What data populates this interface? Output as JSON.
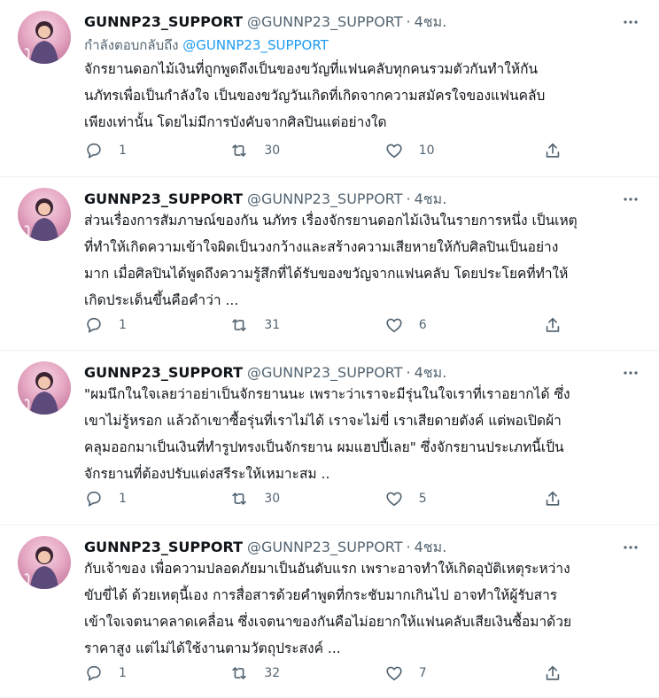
{
  "colors": {
    "text": "#0f1419",
    "secondary": "#536471",
    "link": "#1d9bf0",
    "divider": "#eff3f4",
    "avatar_bg": "#e6a9c4"
  },
  "icons": {
    "more": "more-dots-icon",
    "reply": "reply-bubble-icon",
    "retweet": "retweet-icon",
    "like": "heart-icon",
    "share": "share-upload-icon"
  },
  "tweets": [
    {
      "name": "GUNNP23_SUPPORT",
      "handle": "@GUNNP23_SUPPORT",
      "dot": "·",
      "time": "4ชม.",
      "reply_prefix": "กำลังตอบกลับถึง",
      "reply_mention": "@GUNNP23_SUPPORT",
      "text": "จักรยานดอกไม้เงินที่ถูกพูดถึงเป็นของขวัญที่แฟนคลับทุกคนรวมตัวกันทำให้กัน\nนภัทรเพื่อเป็นกำลังใจ เป็นของขวัญวันเกิดที่เกิดจากความสมัครใจของแฟนคลับ\nเพียงเท่านั้น โดยไม่มีการบังคับจากศิลปินแต่อย่างใด",
      "replies": "1",
      "retweets": "30",
      "likes": "10"
    },
    {
      "name": "GUNNP23_SUPPORT",
      "handle": "@GUNNP23_SUPPORT",
      "dot": "·",
      "time": "4ชม.",
      "text": "ส่วนเรื่องการสัมภาษณ์ของกัน นภัทร เรื่องจักรยานดอกไม้เงินในรายการหนึ่ง เป็นเหตุ\nที่ทำให้เกิดความเข้าใจผิดเป็นวงกว้างและสร้างความเสียหายให้กับศิลปินเป็นอย่าง\nมาก เมื่อศิลปินได้พูดถึงความรู้สึกที่ได้รับของขวัญจากแฟนคลับ โดยประโยคที่ทำให้\nเกิดประเด็นขึ้นคือคำว่า ...",
      "replies": "1",
      "retweets": "31",
      "likes": "6"
    },
    {
      "name": "GUNNP23_SUPPORT",
      "handle": "@GUNNP23_SUPPORT",
      "dot": "·",
      "time": "4ชม.",
      "text": "\"ผมนึกในใจเลยว่าอย่าเป็นจักรยานนะ เพราะว่าเราจะมีรุ่นในใจเราที่เราอยากได้ ซึ่ง\nเขาไม่รู้หรอก แล้วถ้าเขาซื้อรุ่นที่เราไม่ได้ เราจะไม่ขี่ เราเสียดายตังค์ แต่พอเปิดผ้า\nคลุมออกมาเป็นเงินที่ทำรูปทรงเป็นจักรยาน ผมแฮปปี้เลย\" ซึ่งจักรยานประเภทนี้เป็น\nจักรยานที่ต้องปรับแต่งสรีระให้เหมาะสม ..",
      "replies": "1",
      "retweets": "30",
      "likes": "5"
    },
    {
      "name": "GUNNP23_SUPPORT",
      "handle": "@GUNNP23_SUPPORT",
      "dot": "·",
      "time": "4ชม.",
      "text": "กับเจ้าของ เพื่อความปลอดภัยมาเป็นอันดับแรก เพราะอาจทำให้เกิดอุบัติเหตุระหว่าง\nขับขี่ได้ ด้วยเหตุนี้เอง การสื่อสารด้วยคำพูดที่กระชับมากเกินไป อาจทำให้ผู้รับสาร\nเข้าใจเจตนาคลาดเคลื่อน ซึ่งเจตนาของกันคือไม่อยากให้แฟนคลับเสียเงินซื้อมาด้วย\nราคาสูง แต่ไม่ได้ใช้งานตามวัตถุประสงค์ ...",
      "replies": "1",
      "retweets": "32",
      "likes": "7"
    }
  ]
}
